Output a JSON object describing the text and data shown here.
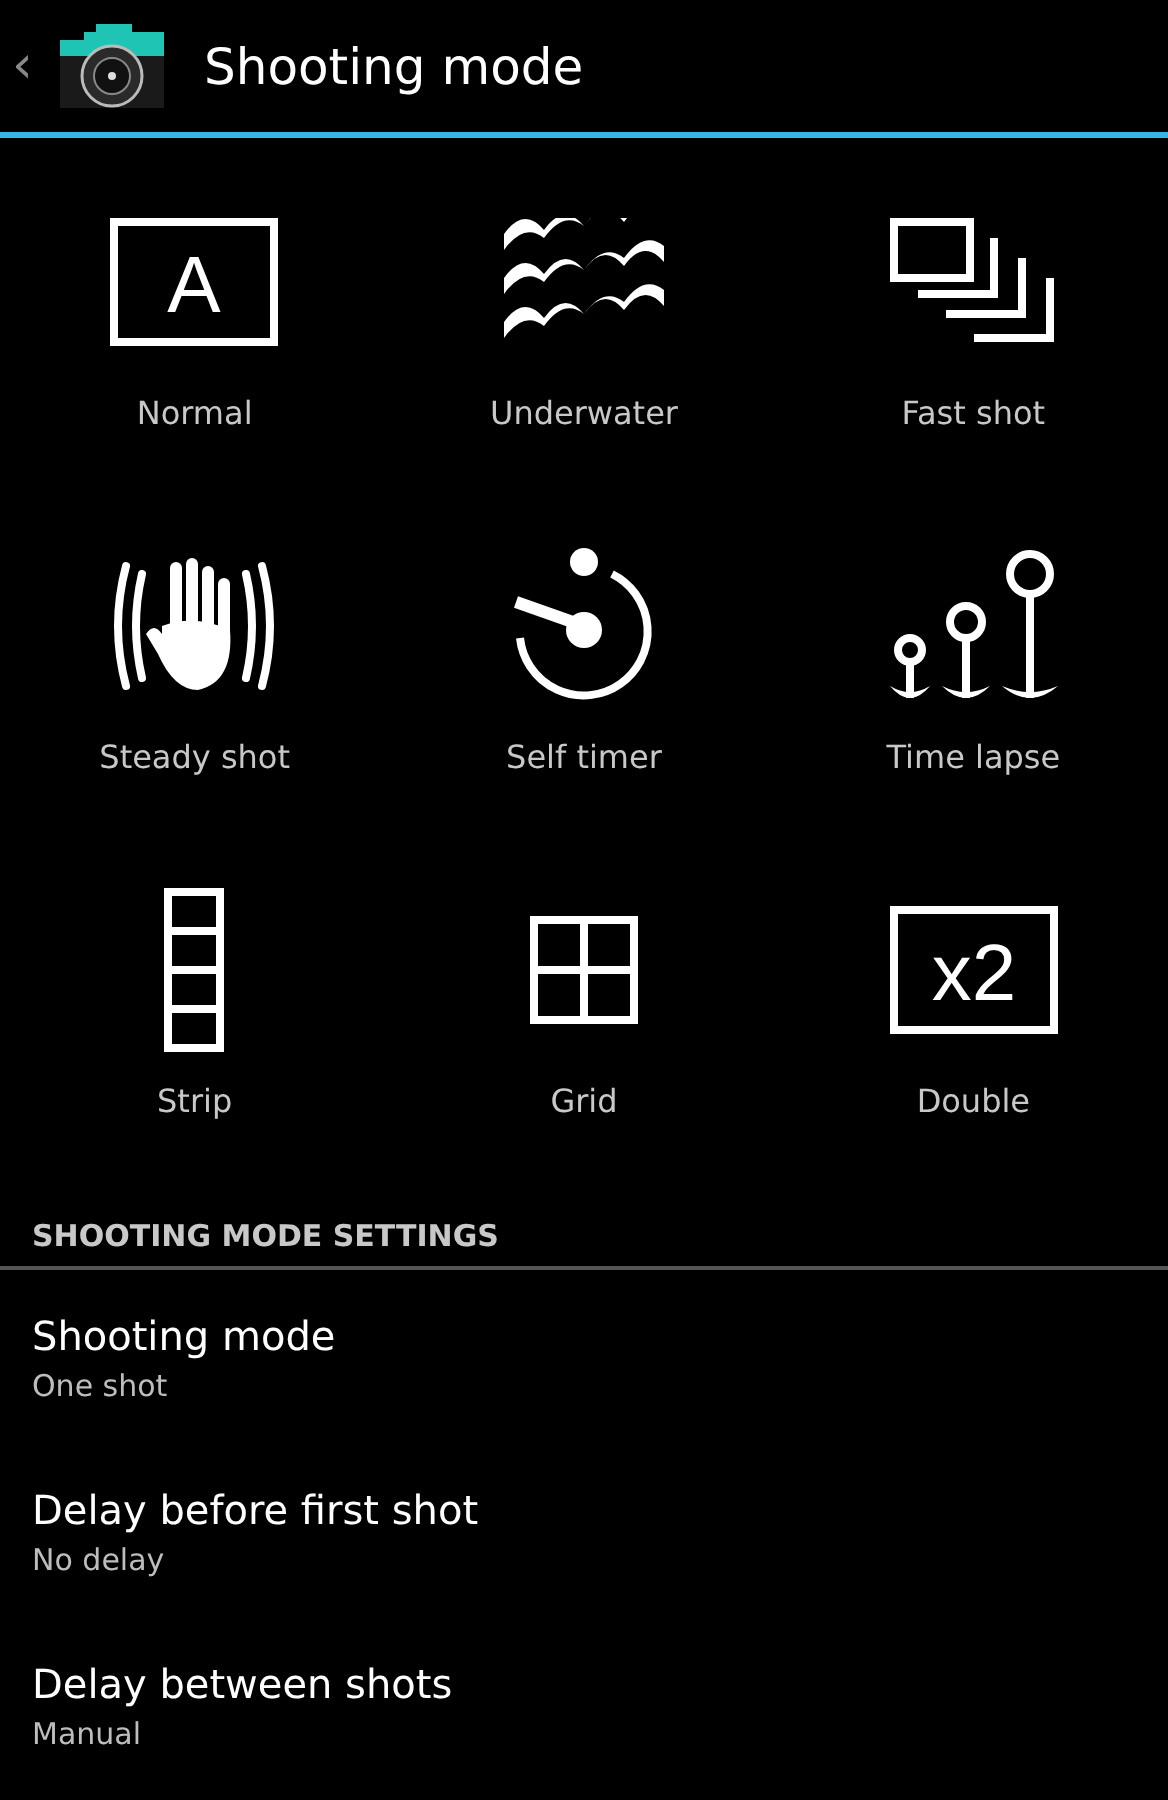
{
  "action_bar": {
    "back": "‹",
    "title": "Shooting mode"
  },
  "modes": [
    {
      "kind": "normal",
      "label": "Normal",
      "icon_text": "A"
    },
    {
      "kind": "underwater",
      "label": "Underwater"
    },
    {
      "kind": "fast",
      "label": "Fast shot"
    },
    {
      "kind": "steady",
      "label": "Steady shot"
    },
    {
      "kind": "timer",
      "label": "Self timer"
    },
    {
      "kind": "lapse",
      "label": "Time lapse"
    },
    {
      "kind": "strip",
      "label": "Strip"
    },
    {
      "kind": "grid",
      "label": "Grid"
    },
    {
      "kind": "double",
      "label": "Double",
      "icon_text": "x2"
    }
  ],
  "settings": {
    "header": "SHOOTING MODE SETTINGS",
    "items": [
      {
        "title": "Shooting mode",
        "value": "One shot"
      },
      {
        "title": "Delay before first shot",
        "value": "No delay"
      },
      {
        "title": "Delay between shots",
        "value": "Manual"
      }
    ]
  }
}
